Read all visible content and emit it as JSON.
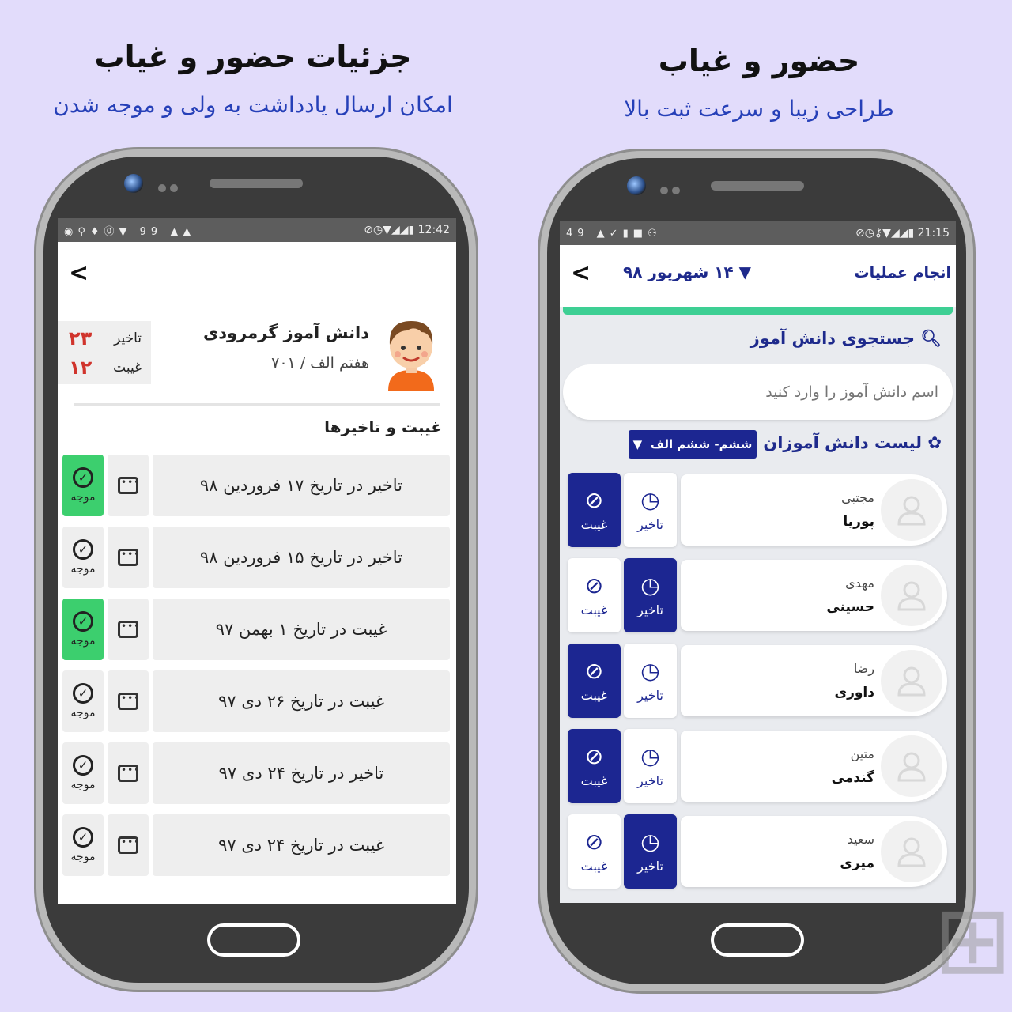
{
  "left_panel": {
    "title": "جزئیات حضور و غیاب",
    "subtitle": "امکان ارسال یادداشت به ولی و موجه شدن",
    "status_bar": {
      "time": "12:42",
      "battery": "99"
    },
    "student": {
      "name": "دانش آموز گرمرودی",
      "class": "هفتم الف / ۷۰۱",
      "late_label": "تاخیر",
      "late_count": "۲۳",
      "absent_label": "غیبت",
      "absent_count": "۱۲"
    },
    "section_title": "غیبت و تاخیرها",
    "status_label": "موجه",
    "records": [
      {
        "text": "تاخیر در تاریخ ۱۷ فروردین ۹۸",
        "excused": true
      },
      {
        "text": "تاخیر در تاریخ ۱۵ فروردین ۹۸",
        "excused": false
      },
      {
        "text": "غیبت در تاریخ ۱ بهمن ۹۷",
        "excused": true
      },
      {
        "text": "غیبت در تاریخ ۲۶ دی ۹۷",
        "excused": false
      },
      {
        "text": "تاخیر در تاریخ ۲۴ دی ۹۷",
        "excused": false
      },
      {
        "text": "غیبت در تاریخ ۲۴ دی ۹۷",
        "excused": false
      }
    ]
  },
  "right_panel": {
    "title": "حضور و غیاب",
    "subtitle": "طراحی زیبا و سرعت ثبت بالا",
    "status_bar": {
      "time": "21:15",
      "left": "49"
    },
    "date_selector": "۱۴ شهریور ۹۸",
    "action_label": "انجام عملیات",
    "search_title": "جستجوی دانش آموز",
    "search_placeholder": "اسم دانش آموز را وارد کنید",
    "list_title": "لیست دانش آموزان",
    "class_selector": "ششم- ششم الف",
    "late_label": "تاخیر",
    "absent_label": "غیبت",
    "students": [
      {
        "first": "مجتبی",
        "last": "پوریا",
        "late": false,
        "absent": true
      },
      {
        "first": "مهدی",
        "last": "حسینی",
        "late": true,
        "absent": false
      },
      {
        "first": "رضا",
        "last": "داوری",
        "late": false,
        "absent": true
      },
      {
        "first": "متین",
        "last": "گندمی",
        "late": false,
        "absent": true
      },
      {
        "first": "سعید",
        "last": "میری",
        "late": true,
        "absent": false
      }
    ]
  },
  "colors": {
    "background": "#e2dcfb",
    "accent_blue": "#1c2691",
    "subtitle_blue": "#2640b8",
    "excused_green": "#3ccf6e",
    "count_red": "#d0342c",
    "progress_green": "#3ecf94"
  }
}
